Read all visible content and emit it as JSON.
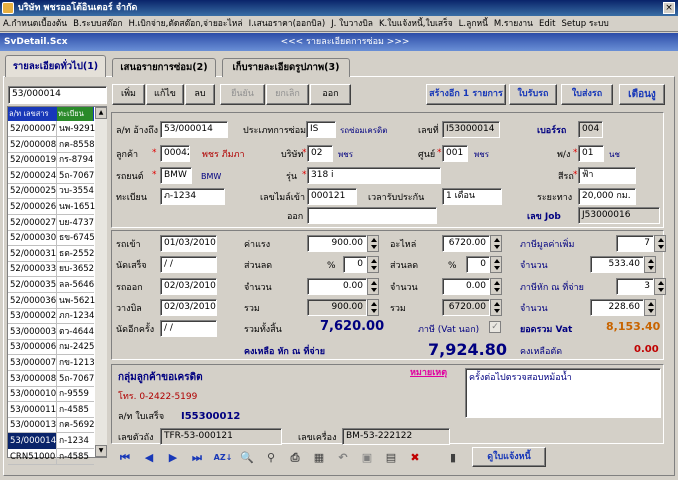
{
  "window": {
    "title": "บริษัท พชรออโต้อินเตอร์  จำกัด"
  },
  "menu": [
    "A.กำหนดเบื้องต้น",
    "B.ระบบสต๊อก",
    "H.เบิกจ่าย,ตัดสต๊อก,จ่ายอะไหล่",
    "I.เสนอราคา(ออกบิล)",
    "J. ใบวางบิล",
    "K.ใบแจ้งหนี้,ใบเสร็จ",
    "L.ลูกหนี้",
    "M.รายงาน",
    "Edit",
    "Setup ระบบ"
  ],
  "child": {
    "name": "SvDetail.Scx",
    "title": "<<< รายละเอียดการซ่อม >>>"
  },
  "tabs": [
    "รายละเอียดทั่วไป(1)",
    "เสนอรายการซ่อม(2)",
    "เก็บรายละเอียดรูปภาพ(3)"
  ],
  "search": {
    "value": "53/000014"
  },
  "toolbar": {
    "add": "เพิ่ม",
    "edit": "แก้ไข",
    "delete": "ลบ",
    "confirm": "ยืนยัน",
    "cancel": "ยกเลิก",
    "exit": "ออก",
    "create_more": "สร้างอีก 1 รายการ",
    "receive_car": "ใบรับรถ",
    "deliver_car": "ใบส่งรถ",
    "warning": "เตือนงู"
  },
  "list": {
    "headers": [
      "ล/ท เลขสาร",
      "ทะเบียน"
    ],
    "rows": [
      [
        "52/000007",
        "นพ-9291"
      ],
      [
        "52/000008",
        "กค-8558"
      ],
      [
        "52/000019",
        "กร-8794"
      ],
      [
        "52/000024",
        "5ถ-7067"
      ],
      [
        "52/000025",
        "วบ-3554"
      ],
      [
        "52/000026",
        "นพ-1651"
      ],
      [
        "52/000027",
        "บย-4737"
      ],
      [
        "52/000030",
        "ธข-6745"
      ],
      [
        "52/000031",
        "ธต-2552"
      ],
      [
        "52/000033",
        "ยบ-3652"
      ],
      [
        "52/000035",
        "ลล-5646"
      ],
      [
        "52/000036",
        "นพ-5621"
      ],
      [
        "53/000002",
        "ภก-1234"
      ],
      [
        "53/000003",
        "ตว-4644"
      ],
      [
        "53/000006",
        "กม-2425"
      ],
      [
        "53/000007",
        "กข-1213"
      ],
      [
        "53/000008",
        "5ถ-7067"
      ],
      [
        "53/000010",
        "ก-9559"
      ],
      [
        "53/000011",
        "ก-4585"
      ],
      [
        "53/000013",
        "กค-5692"
      ],
      [
        "53/000014",
        "ก-1234"
      ],
      [
        "CRN51000",
        "ก-4585"
      ]
    ],
    "selected": 20
  },
  "header": {
    "ref_label": "ล/ท อ้างถึง",
    "ref": "53/000014",
    "repair_type_label": "ประเภทการซ่อม",
    "repair_type_code": "IS",
    "repair_type_name": "รถซ่อมเครดิต",
    "doc_no_label": "เลขที่",
    "doc_no": "I53000014",
    "garage_label": "เบอร์รถ",
    "garage": "004",
    "customer_label": "ลูกค้า",
    "customer_code": "00042",
    "customer_name": "พชร ภีมภา",
    "company_label": "บริษัท",
    "company_code": "02",
    "company_name": "พชร",
    "center_label": "ศูนย์",
    "center_code": "001",
    "center_name": "พชร",
    "branch_label": "พ/ง",
    "branch_code": "01",
    "branch_name": "นช",
    "brand_label": "รถยนต์",
    "brand_code": "BMW",
    "brand_name": "BMW",
    "model_label": "รุ่น",
    "model": "318 i",
    "color_label": "สีรถ",
    "color": "ฟ้า",
    "plate_label": "ทะเบียน",
    "plate": "ภ-1234",
    "mileage_label": "เลขไมล์เข้า",
    "mileage": "000121",
    "warranty_label": "เวลารับประกัน",
    "warranty": "1 เดือน",
    "distance_label": "ระยะทาง",
    "distance": "20,000 กม.",
    "out_label": "ออก",
    "job_label": "เลข Job",
    "job": "J53000016"
  },
  "dates": {
    "in_label": "รถเข้า",
    "in": "01/03/2010",
    "done_label": "นัดเสร็จ",
    "done": "/ /",
    "out_label": "รถออก",
    "out": "02/03/2010",
    "bill_label": "วางบิล",
    "bill": "02/03/2010",
    "appt_label": "นัดอีกครั้ง",
    "appt": "/ /"
  },
  "labor": {
    "label": "ค่าแรง",
    "value": "900.00",
    "disc_label": "ส่วนลด",
    "pct": "%",
    "disc": "0",
    "qty_label": "จำนวน",
    "qty": "0.00",
    "sum_label": "รวม",
    "sum": "900.00"
  },
  "parts": {
    "label": "อะไหล่",
    "value": "6720.00",
    "disc_label": "ส่วนลด",
    "pct": "%",
    "disc": "0",
    "qty_label": "จำนวน",
    "qty": "0.00",
    "sum_label": "รวม",
    "sum": "6720.00"
  },
  "tax": {
    "vat_label": "ภาษีมูลค่าเพิ่ม",
    "vat_pct": "7",
    "vat_amt_label": "จำนวน",
    "vat_amt": "533.40",
    "wht_label": "ภาษีหัก ณ ที่จ่าย",
    "wht_pct": "3",
    "wht_amt_label": "จำนวน",
    "wht_amt": "228.60"
  },
  "totals": {
    "total_label": "รวมทั้งสิ้น",
    "total": "7,620.00",
    "vat_in_label": "ภาษี (Vat นอก)",
    "grand_vat_label": "ยอดรวม Vat",
    "grand_vat": "8,153.40",
    "net_label": "คงเหลือ หัก ณ ที่จ่าย",
    "net": "7,924.80",
    "remaining_label": "คงเหลือตัด",
    "remaining": "0.00"
  },
  "footer": {
    "group": "กลุ่มลูกค้าขอเครดิต",
    "phone": "โทร. 0-2422-5199",
    "note_label": "หมายเหตุ",
    "note": "ครั้งต่อไปตรวจสอบหม้อน้ำ",
    "receipt_label": "ล/ท ใบเสร็จ",
    "receipt": "I55300012",
    "chassis_label": "เลขตัวถัง",
    "chassis": "TFR-53-000121",
    "engine_label": "เลขเครื่อง",
    "engine": "BM-53-222122"
  },
  "nav": {
    "notify": "ดูใบแจ้งหนี้"
  }
}
